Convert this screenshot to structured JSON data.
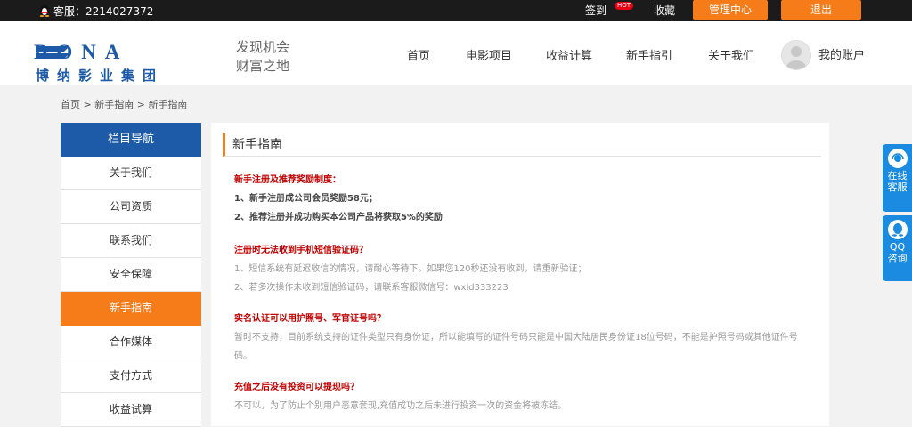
{
  "topbar": {
    "service_text": "客服：2214027372",
    "sign_in": "签到",
    "hot_badge": "HOT",
    "favorite": "收藏",
    "manage_center": "管理中心",
    "logout": "退出"
  },
  "header": {
    "logo_text": "BONA",
    "logo_subtext": "博纳影业集团",
    "slogan_line1": "发现机会",
    "slogan_line2": "财富之地",
    "nav": [
      "首页",
      "电影项目",
      "收益计算",
      "新手指引",
      "关于我们"
    ],
    "account": "我的账户"
  },
  "breadcrumb": {
    "item1": "首页",
    "sep": ">",
    "item2": "新手指南",
    "item3": "新手指南"
  },
  "sidebar": {
    "title": "栏目导航",
    "items": [
      "关于我们",
      "公司资质",
      "联系我们",
      "安全保障",
      "新手指南",
      "合作媒体",
      "支付方式",
      "收益试算"
    ],
    "active_index": 4
  },
  "content": {
    "title": "新手指南",
    "sections": [
      {
        "question": "新手注册及推荐奖励制度：",
        "lines": [
          "1、新手注册成公司会员奖励58元；",
          "2、推荐注册并成功购买本公司产品将获取5%的奖励"
        ]
      },
      {
        "question": "注册时无法收到手机短信验证码？",
        "lines": [
          "1、短信系统有延迟收信的情况，请耐心等待下。如果您120秒还没有收到，请重新验证；",
          "2、若多次操作未收到短信验证码，请联系客服微信号：wxid333223"
        ]
      },
      {
        "question": "实名认证可以用护照号、军官证号吗？",
        "lines": [
          "暂时不支持，目前系统支持的证件类型只有身份证，所以能填写的证件号码只能是中国大陆居民身份证18位号码，不能是护照号码或其他证件号码。"
        ]
      },
      {
        "question": "充值之后没有投资可以提现吗？",
        "lines": [
          "不可以，为了防止个别用户恶意套现,充值成功之后未进行投资一次的资金将被冻结。"
        ]
      }
    ]
  },
  "float": {
    "online_service_line1": "在线",
    "online_service_line2": "客服",
    "qq_line1": "QQ",
    "qq_line2": "咨询"
  },
  "colors": {
    "accent_orange": "#f67c1a",
    "nav_blue": "#1d5aa8",
    "float_blue": "#1a8be0",
    "question_red": "#c00000"
  }
}
